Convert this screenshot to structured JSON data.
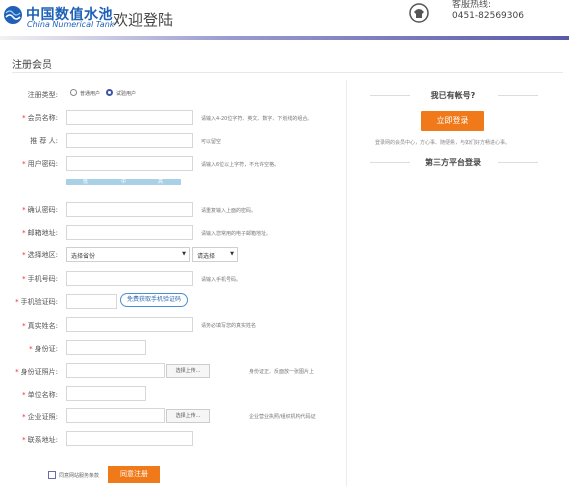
{
  "header": {
    "logo_cn": "中国数值水池",
    "logo_en": "China Numerical Tank",
    "welcome": "欢迎登陆",
    "hotline_label": "客服热线:",
    "hotline_number": "0451-82569306"
  },
  "page_title": "注册会员",
  "user_type": {
    "label": "注册类型:",
    "options": [
      "普通用户",
      "试验用户"
    ],
    "selected": "试验用户"
  },
  "fields": {
    "member_name": {
      "label": "会员名称:",
      "hint": "请输入4-20位字符、英文、数字、下划线的组合。"
    },
    "referrer": {
      "label": "推 荐 人:",
      "hint": "可以留空"
    },
    "password": {
      "label": "用户密码:",
      "hint": "请输入6位以上字符，不允许空格。"
    },
    "strength": [
      "低",
      "中",
      "高"
    ],
    "confirm_password": {
      "label": "确认密码:",
      "hint": "请重复输入上面的密码。"
    },
    "email": {
      "label": "邮箱地址:",
      "hint": "请输入您常用的电子邮箱地址。"
    },
    "region": {
      "label": "选择地区:",
      "province": "选择省份",
      "city": "请选择"
    },
    "phone": {
      "label": "手机号码:",
      "hint": "请输入手机号码。"
    },
    "sms_code": {
      "label": "手机验证码:",
      "button": "免费获取手机验证码"
    },
    "real_name": {
      "label": "真实姓名:",
      "hint": "请务必填写您的真实姓名"
    },
    "id_number": {
      "label": "身份证:"
    },
    "id_photo": {
      "label": "身份证照片:",
      "button": "选择上传...",
      "hint": "身份证正、反面放一张图片上"
    },
    "company": {
      "label": "单位名称:"
    },
    "business_license": {
      "label": "企业证照:",
      "button": "选择上传...",
      "hint": "企业营业执照/组织机构代码证"
    },
    "address": {
      "label": "联系地址:"
    }
  },
  "agree": {
    "text": "同意网站服务条款",
    "submit": "同意注册"
  },
  "side": {
    "have_account": "我已有帐号?",
    "login_button": "立即登录",
    "note": "登录网的会员中心，方心事、随便惫，与如们好方畅进心事。",
    "third_party": "第三方平台登录"
  },
  "colors": {
    "accent": "#f07a1a",
    "brand": "#1e61b6",
    "required": "#ee2233"
  }
}
